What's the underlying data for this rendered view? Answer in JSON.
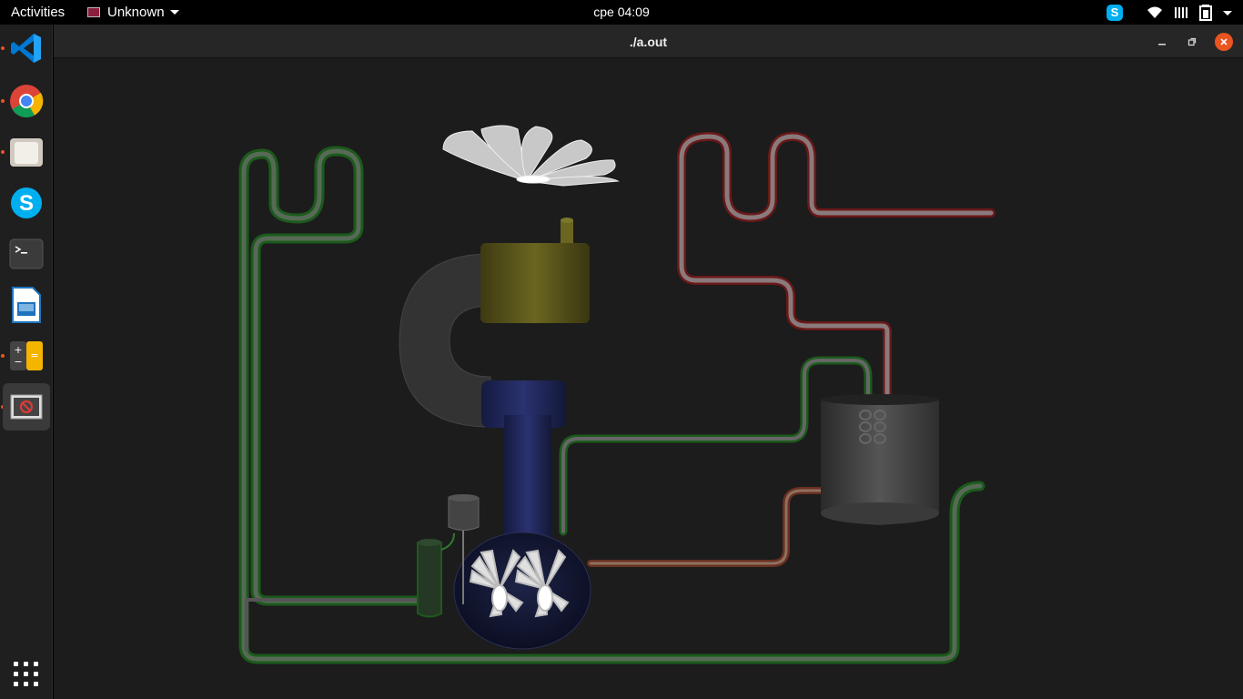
{
  "topbar": {
    "activities_label": "Activities",
    "app_menu_label": "Unknown",
    "clock": "срe 04:09",
    "tray_icons": [
      "skype-icon",
      "wifi-icon",
      "volume-icon",
      "battery-icon",
      "system-menu-caret-icon"
    ]
  },
  "dock": {
    "items": [
      {
        "name": "Visual Studio Code",
        "icon": "vscode-icon",
        "running": true
      },
      {
        "name": "Google Chrome",
        "icon": "chrome-icon",
        "running": true
      },
      {
        "name": "Files",
        "icon": "files-icon",
        "running": true
      },
      {
        "name": "Skype",
        "icon": "skype-icon",
        "running": false
      },
      {
        "name": "Terminal",
        "icon": "terminal-icon",
        "running": false
      },
      {
        "name": "LibreOffice Impress",
        "icon": "impress-icon",
        "running": false
      },
      {
        "name": "Calculator",
        "icon": "calculator-icon",
        "running": true
      },
      {
        "name": "a.out",
        "icon": "generic-app-icon",
        "running": true,
        "active": true
      }
    ],
    "show_apps_icon": "apps-grid-icon"
  },
  "window": {
    "title": "./a.out",
    "controls": [
      "minimize-icon",
      "maximize-icon",
      "close-icon"
    ]
  },
  "scene": {
    "description_free": true,
    "background_color": "#1c1c1c",
    "pipe_colors": {
      "coolant": "#2f7a2f",
      "hot": "#8a2a2a",
      "steam": "#d06040"
    }
  },
  "colors": {
    "accent": "#e95420",
    "topbar_bg": "#000000",
    "dock_bg": "#1f1f1f",
    "titlebar_bg": "#262626"
  }
}
